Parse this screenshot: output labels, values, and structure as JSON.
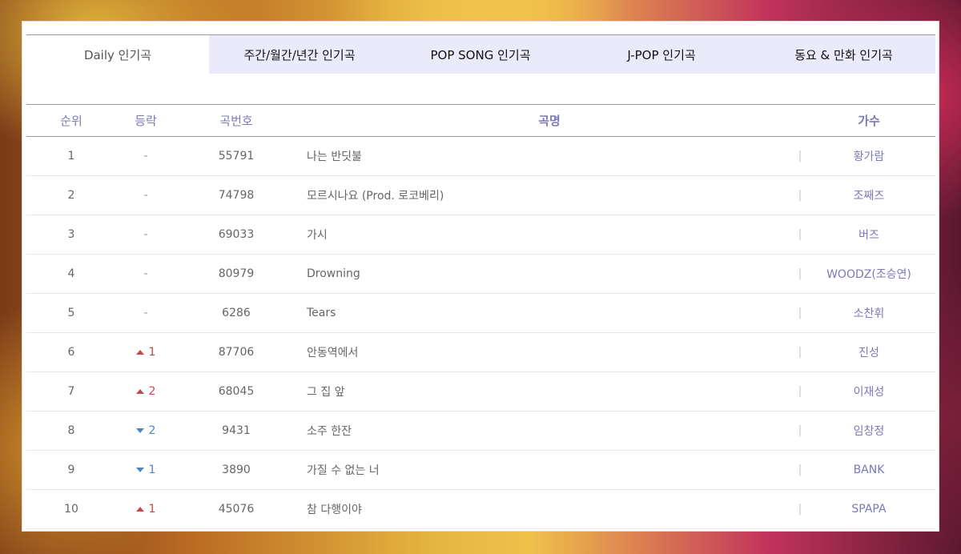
{
  "tabs": [
    {
      "label": "Daily 인기곡",
      "active": true
    },
    {
      "label": "주간/월간/년간 인기곡",
      "active": false
    },
    {
      "label": "POP SONG 인기곡",
      "active": false
    },
    {
      "label": "J-POP 인기곡",
      "active": false
    },
    {
      "label": "동요 & 만화 인기곡",
      "active": false
    }
  ],
  "table": {
    "headers": {
      "rank": "순위",
      "change": "등락",
      "number": "곡번호",
      "title": "곡명",
      "artist": "가수"
    },
    "separator": "|",
    "rows": [
      {
        "rank": "1",
        "change_dir": "none",
        "change": "-",
        "number": "55791",
        "title": "나는 반딧불",
        "artist": "황가람"
      },
      {
        "rank": "2",
        "change_dir": "none",
        "change": "-",
        "number": "74798",
        "title": "모르시나요 (Prod. 로코베리)",
        "artist": "조째즈"
      },
      {
        "rank": "3",
        "change_dir": "none",
        "change": "-",
        "number": "69033",
        "title": "가시",
        "artist": "버즈"
      },
      {
        "rank": "4",
        "change_dir": "none",
        "change": "-",
        "number": "80979",
        "title": "Drowning",
        "artist": "WOODZ(조승연)"
      },
      {
        "rank": "5",
        "change_dir": "none",
        "change": "-",
        "number": "6286",
        "title": "Tears",
        "artist": "소찬휘"
      },
      {
        "rank": "6",
        "change_dir": "up",
        "change": "1",
        "number": "87706",
        "title": "안동역에서",
        "artist": "진성"
      },
      {
        "rank": "7",
        "change_dir": "up",
        "change": "2",
        "number": "68045",
        "title": "그 집 앞",
        "artist": "이재성"
      },
      {
        "rank": "8",
        "change_dir": "down",
        "change": "2",
        "number": "9431",
        "title": "소주 한잔",
        "artist": "임창정"
      },
      {
        "rank": "9",
        "change_dir": "down",
        "change": "1",
        "number": "3890",
        "title": "가질 수 없는 너",
        "artist": "BANK"
      },
      {
        "rank": "10",
        "change_dir": "up",
        "change": "1",
        "number": "45076",
        "title": "참 다행이야",
        "artist": "SPAPA"
      }
    ]
  },
  "colors": {
    "accent": "#7d78b8",
    "tab_bg": "#ebeafa",
    "up": "#c8484a",
    "down": "#4e86c0"
  }
}
